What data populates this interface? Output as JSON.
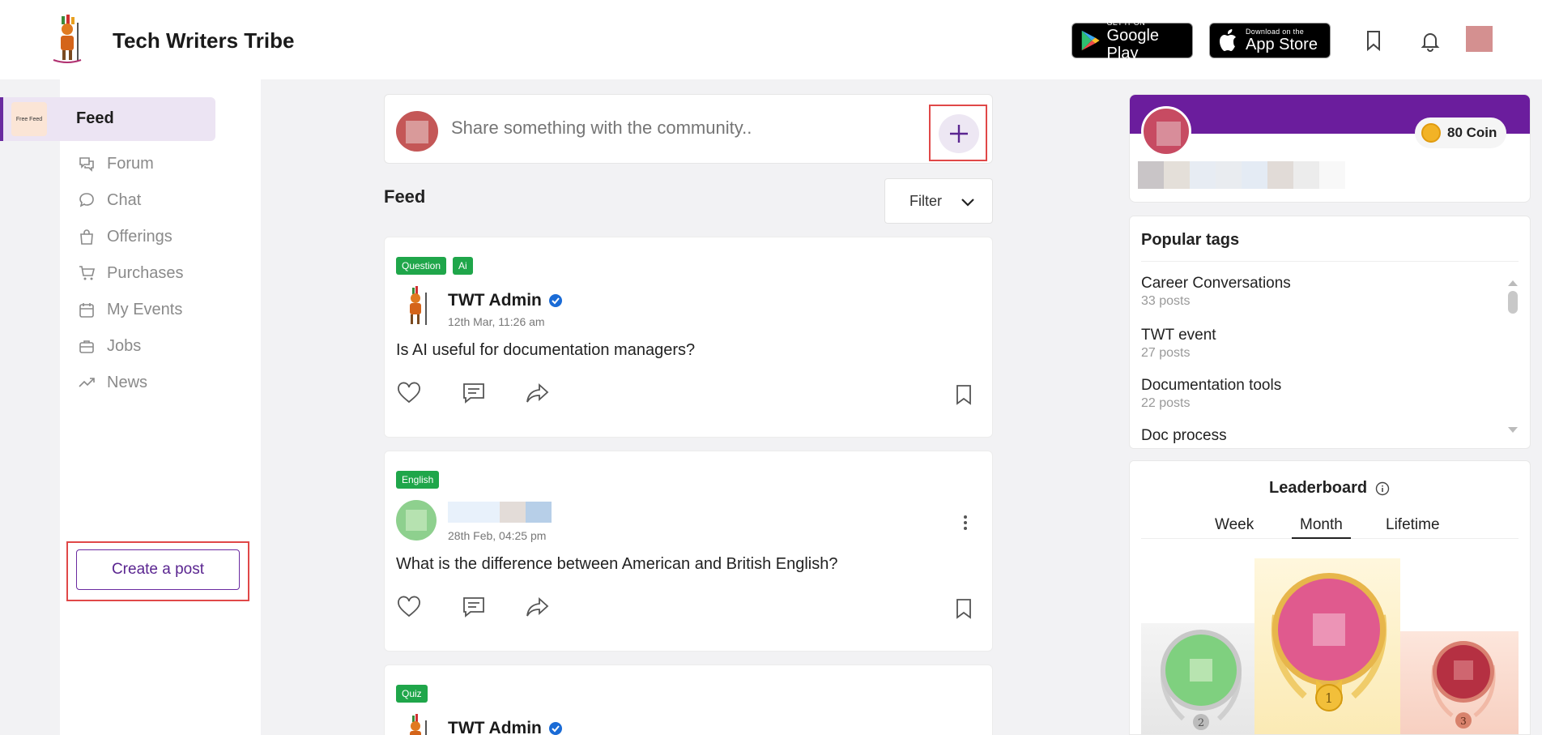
{
  "header": {
    "brand": "Tech Writers Tribe",
    "google_play": {
      "small": "GET IT ON",
      "big": "Google Play"
    },
    "app_store": {
      "small": "Download on the",
      "big": "App Store"
    }
  },
  "sidebar": {
    "active": {
      "thumb": "Free Feed",
      "label": "Feed"
    },
    "items": [
      {
        "label": "Forum",
        "icon": "forum-icon"
      },
      {
        "label": "Chat",
        "icon": "chat-icon"
      },
      {
        "label": "Offerings",
        "icon": "bag-icon"
      },
      {
        "label": "Purchases",
        "icon": "cart-icon"
      },
      {
        "label": "My Events",
        "icon": "calendar-icon"
      },
      {
        "label": "Jobs",
        "icon": "briefcase-icon"
      },
      {
        "label": "News",
        "icon": "trend-icon"
      }
    ],
    "create_post": "Create a post"
  },
  "composer": {
    "placeholder": "Share something with the community.."
  },
  "feed": {
    "title": "Feed",
    "filter": "Filter",
    "posts": [
      {
        "tags": [
          "Question",
          "Ai"
        ],
        "author": "TWT Admin",
        "date": "12th Mar, 11:26 am",
        "text": "Is AI useful for documentation managers?"
      },
      {
        "tags": [
          "English"
        ],
        "author": "",
        "date": "28th Feb, 04:25 pm",
        "text": "What is the difference between American and British English?"
      },
      {
        "tags": [
          "Quiz"
        ],
        "author": "TWT Admin",
        "date": "",
        "text": ""
      }
    ]
  },
  "profile": {
    "coin": "80 Coin"
  },
  "popular_tags": {
    "title": "Popular tags",
    "items": [
      {
        "name": "Career Conversations",
        "count": "33 posts"
      },
      {
        "name": "TWT event",
        "count": "27 posts"
      },
      {
        "name": "Documentation tools",
        "count": "22 posts"
      },
      {
        "name": "Doc process",
        "count": ""
      }
    ]
  },
  "leaderboard": {
    "title": "Leaderboard",
    "tabs": [
      "Week",
      "Month",
      "Lifetime"
    ],
    "active_tab": "Month",
    "ranks": [
      "2",
      "1",
      "3"
    ]
  },
  "colors": {
    "accent": "#6b1d9d",
    "tag_green": "#1fa64a",
    "highlight_red": "#e04848"
  }
}
